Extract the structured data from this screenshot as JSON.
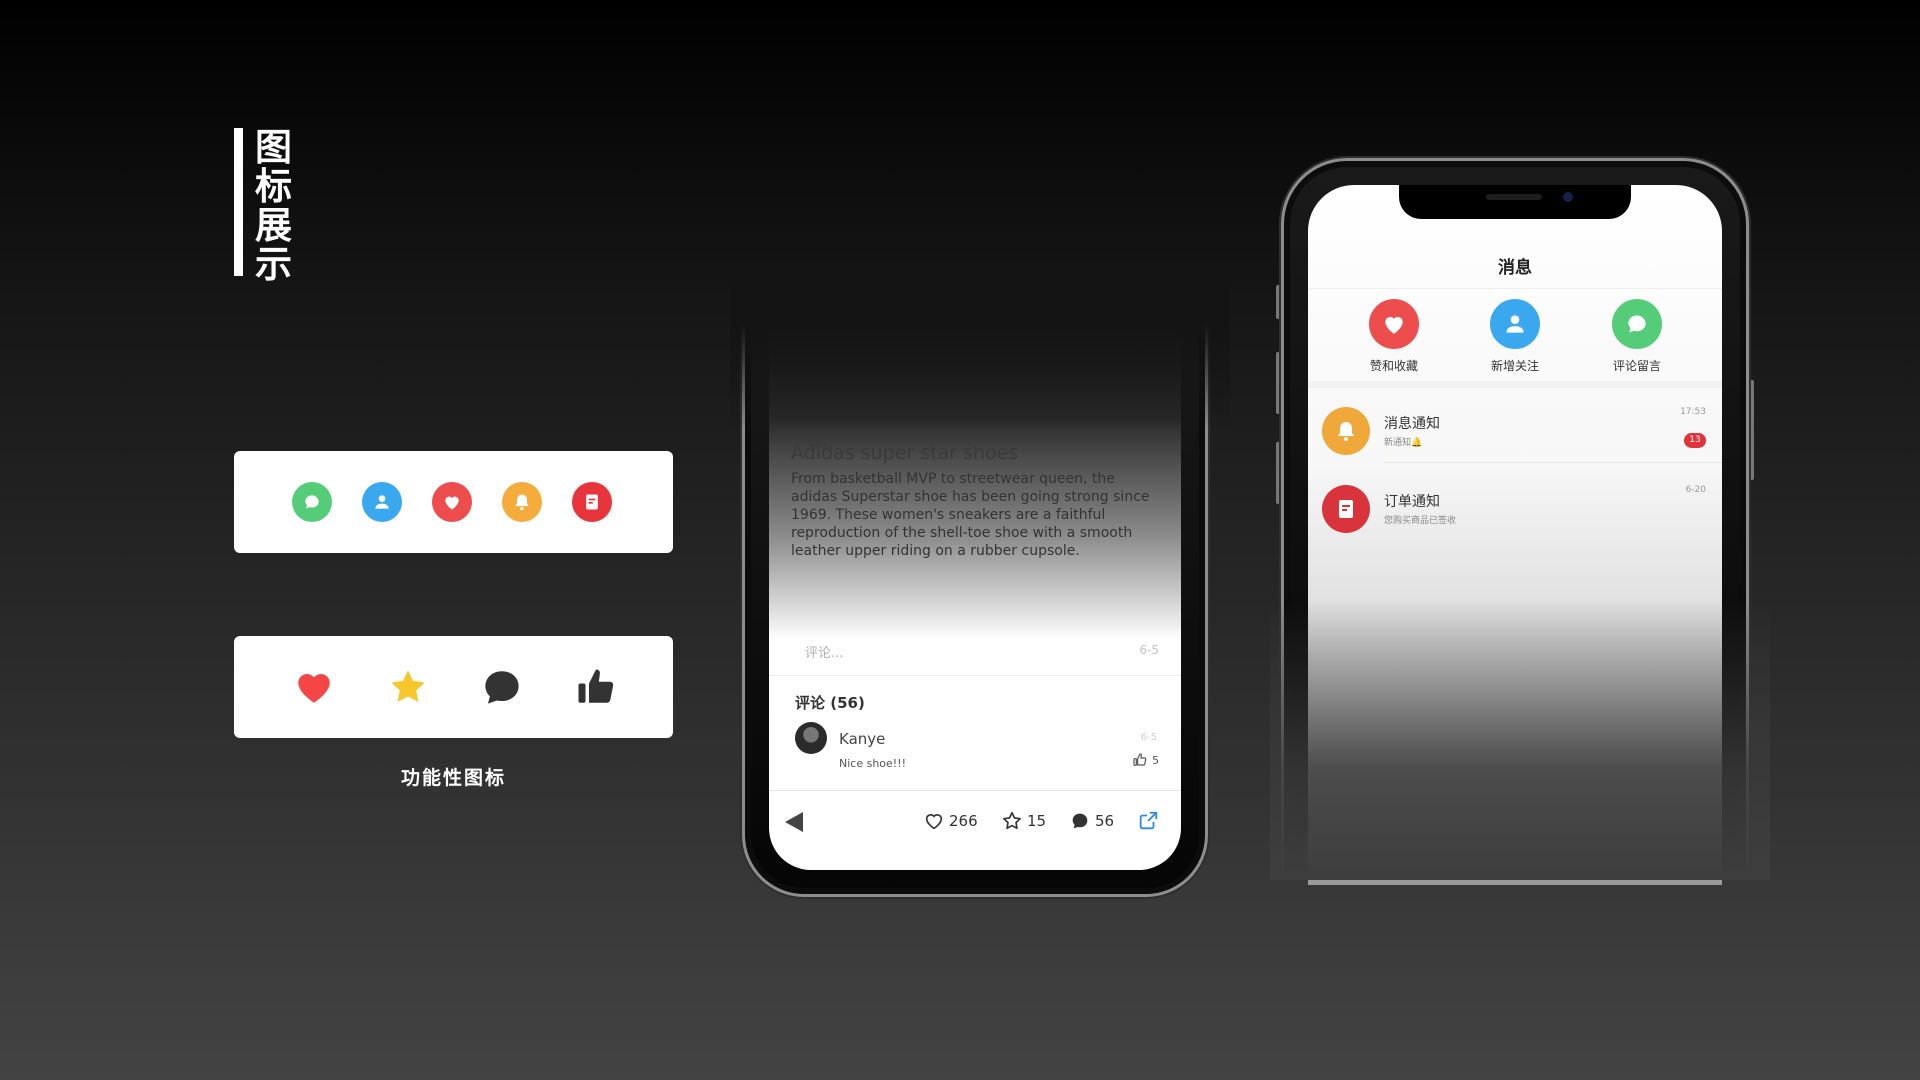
{
  "heading": {
    "title": "图标展示"
  },
  "card1": {
    "icons": [
      {
        "name": "comment-icon",
        "color": "#55cc77"
      },
      {
        "name": "user-icon",
        "color": "#3aa8ef"
      },
      {
        "name": "heart-icon",
        "color": "#ee4d4d"
      },
      {
        "name": "bell-icon",
        "color": "#f6ac3d"
      },
      {
        "name": "order-icon",
        "color": "#e8343b"
      }
    ]
  },
  "card2": {
    "icons": [
      {
        "name": "heart-icon",
        "color": "#f64545"
      },
      {
        "name": "star-icon",
        "color": "#f7c72b"
      },
      {
        "name": "comment-icon",
        "color": "#333333"
      },
      {
        "name": "thumbs-up-icon",
        "color": "#333333"
      }
    ],
    "caption": "功能性图标"
  },
  "product": {
    "title": "Adidas super star shoes",
    "description": "From basketball MVP to streetwear queen, the adidas Superstar shoe has been going strong since 1969. These women's sneakers are a faithful reproduction of the shell-toe shoe with a smooth leather upper riding on a rubber cupsole.",
    "comment_placeholder": "评论...",
    "date": "6-5",
    "comments_title": "评论 (56)",
    "comment": {
      "user": "Kanye",
      "text": "Nice shoe!!!",
      "date": "6-5",
      "likes": "5"
    },
    "bar": {
      "likes": "266",
      "favorites": "15",
      "comments": "56"
    }
  },
  "messages": {
    "title": "消息",
    "categories": [
      {
        "label": "赞和收藏",
        "icon": "heart-icon",
        "color": "#ee4d4d"
      },
      {
        "label": "新增关注",
        "icon": "user-icon",
        "color": "#3aa8ef"
      },
      {
        "label": "评论留言",
        "icon": "comment-icon",
        "color": "#55cc77"
      }
    ],
    "items": [
      {
        "title": "消息通知",
        "subtitle": "新通知🔔",
        "time": "17:53",
        "badge": "13",
        "icon": "bell-icon",
        "color": "#f0a83a"
      },
      {
        "title": "订单通知",
        "subtitle": "您购买商品已签收",
        "time": "6-20",
        "icon": "order-icon",
        "color": "#d9343b"
      }
    ]
  }
}
